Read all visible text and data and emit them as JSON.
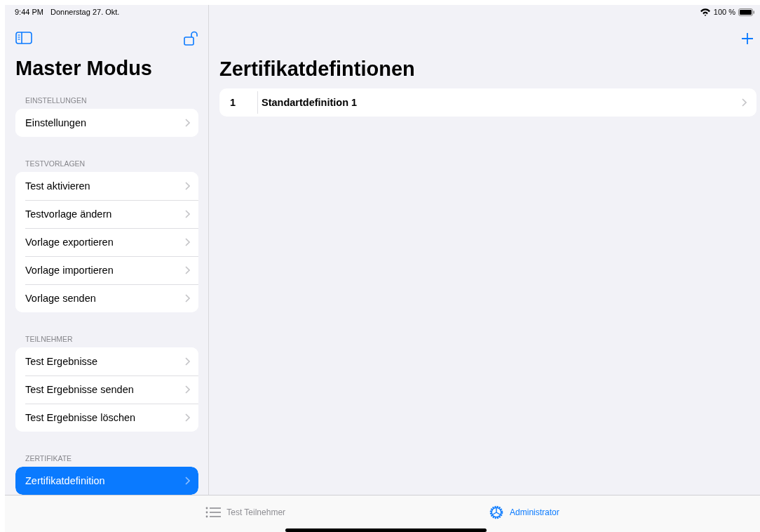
{
  "status_bar": {
    "time": "9:44 PM",
    "date": "Donnerstag 27. Okt.",
    "battery": "100 %"
  },
  "sidebar": {
    "title": "Master Modus",
    "sections": [
      {
        "header": "EINSTELLUNGEN",
        "items": [
          {
            "label": "Einstellungen",
            "selected": false
          }
        ]
      },
      {
        "header": "TESTVORLAGEN",
        "items": [
          {
            "label": "Test aktivieren",
            "selected": false
          },
          {
            "label": "Testvorlage ändern",
            "selected": false
          },
          {
            "label": "Vorlage exportieren",
            "selected": false
          },
          {
            "label": "Vorlage importieren",
            "selected": false
          },
          {
            "label": "Vorlage senden",
            "selected": false
          }
        ]
      },
      {
        "header": "TEILNEHMER",
        "items": [
          {
            "label": "Test Ergebnisse",
            "selected": false
          },
          {
            "label": "Test Ergebnisse senden",
            "selected": false
          },
          {
            "label": "Test Ergebnisse löschen",
            "selected": false
          }
        ]
      },
      {
        "header": "ZERTIFIKATE",
        "items": [
          {
            "label": "Zertifikatdefinition",
            "selected": true
          }
        ]
      }
    ]
  },
  "detail": {
    "title": "Zertifikatdefintionen",
    "rows": [
      {
        "number": "1",
        "label": "Standartdefinition 1"
      }
    ]
  },
  "tab_bar": [
    {
      "kind": "list",
      "label": "Test Teilnehmer",
      "selected": false
    },
    {
      "kind": "gear",
      "label": "Administrator",
      "selected": true
    }
  ]
}
